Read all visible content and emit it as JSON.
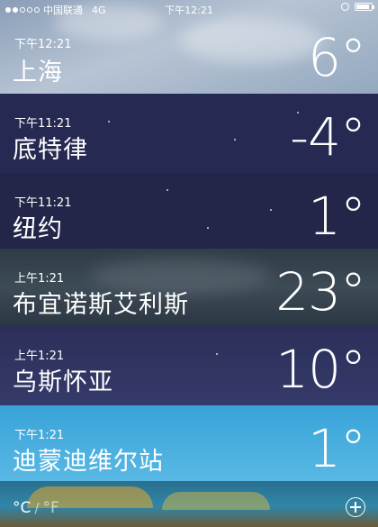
{
  "status_bar": {
    "carrier": "中国联通",
    "network": "4G",
    "time": "下午12:21",
    "signal_filled": 2,
    "signal_total": 5
  },
  "cities": [
    {
      "time": "下午12:21",
      "name": "上海",
      "temp": "6°"
    },
    {
      "time": "下午11:21",
      "name": "底特律",
      "temp": "-4°"
    },
    {
      "time": "下午11:21",
      "name": "纽约",
      "temp": "1°"
    },
    {
      "time": "上午1:21",
      "name": "布宜诺斯艾利斯",
      "temp": "23°"
    },
    {
      "time": "上午1:21",
      "name": "乌斯怀亚",
      "temp": "10°"
    },
    {
      "time": "下午1:21",
      "name": "迪蒙迪维尔站",
      "temp": "1°"
    }
  ],
  "bottom_bar": {
    "celsius_label": "°C",
    "separator": "/",
    "fahrenheit_label": "°F",
    "add_icon": "plus-circle-icon"
  },
  "colors": {
    "row_shanghai": "#a3b3c7",
    "row_detroit": "#262a52",
    "row_newyork": "#232649",
    "row_buenosaires": "#36434f",
    "row_ushuaia": "#2f3462",
    "row_dumontdurville": "#45abde"
  }
}
